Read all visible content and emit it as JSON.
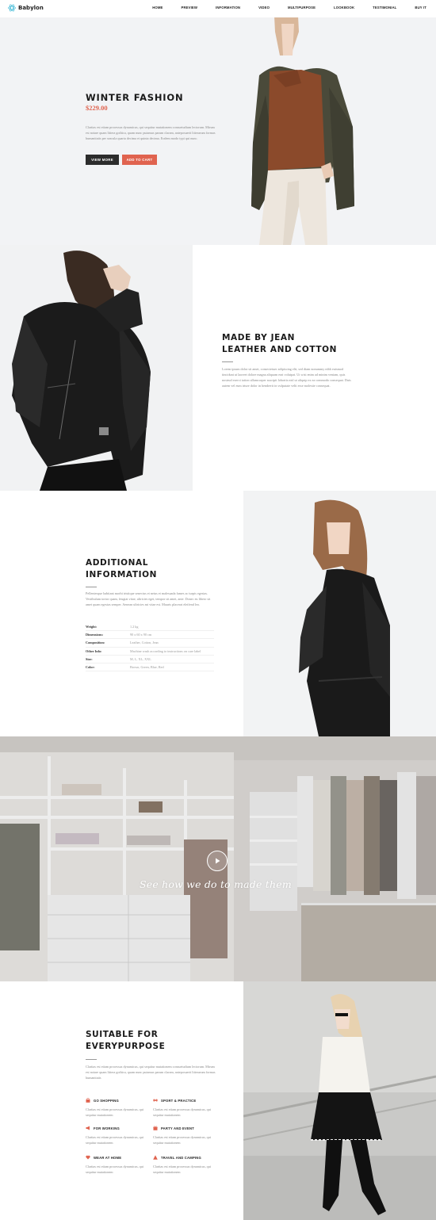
{
  "nav": {
    "logo": "Babylon",
    "items": [
      "HOME",
      "PREVIEW",
      "INFORMATION",
      "VIDEO",
      "MULTIPURPOSE",
      "LOOKBOOK",
      "TESTIMONIAL",
      "BUY IT"
    ]
  },
  "hero": {
    "title": "WINTER FASHION",
    "price": "$229.00",
    "text": "Claritas est etiam processus dynamicus, qui sequitur mutationem consuetudium lectorum. Mirum est notare quam littera gothica, quam nunc putamus parum claram, anteposuerit litterarum formas humanitatis per seacula quarta decima et quinta decima. Eodem modo typi qui nunc.",
    "btn_more": "VIEW MORE",
    "btn_cart": "ADD TO CART"
  },
  "made": {
    "title_line1": "MADE BY JEAN",
    "title_line2": "LEATHER AND COTTON",
    "text": "Lorem ipsum dolor sit amet, consectetuer adipiscing elit, sed diam nonummy nibh euismod tincidunt ut laoreet dolore magna aliquam erat volutpat. Ut wisi enim ad minim veniam, quis nostrud exerci tation ullamcorper suscipit lobortis nisl ut aliquip ex ea commodo consequat. Duis autem vel eum iriure dolor in hendrerit in vulputate velit esse molestie consequat."
  },
  "info": {
    "title_line1": "ADDITIONAL",
    "title_line2": "INFORMATION",
    "text": "Pellentesque habitant morbi tristique senectus et netus et malesuada fames ac turpis egestas. Vestibulum tortor quam, feugiat vitae, ultricies eget, tempor sit amet, ante. Donec eu libero sit amet quam egestas semper. Aenean ultricies mi vitae est. Mauris placerat eleifend leo.",
    "specs": [
      {
        "key": "Weight:",
        "value": "1.2 kg"
      },
      {
        "key": "Dimensions:",
        "value": "90 x 60 x 90 cm"
      },
      {
        "key": "Composition:",
        "value": "Leather, Cotton, Jean"
      },
      {
        "key": "Other Info:",
        "value": "Machine wash according to instructions on care label"
      },
      {
        "key": "Size:",
        "value": "M, L, XL, XXL"
      },
      {
        "key": "Color:",
        "value": "Brown, Green, Blue, Red"
      }
    ]
  },
  "video": {
    "caption": "See  how we do to made them"
  },
  "purpose": {
    "title_line1": "SUITABLE FOR",
    "title_line2": "EVERYPURPOSE",
    "text": "Claritas est etiam processus dynamicus, qui sequitur mutationem consuetudium lectorum. Mirum est notare quam littera gothica, quam nunc putamus parum claram, anteposuerit litterarum formas humanitatis",
    "features": [
      {
        "title": "GO SHOPPING",
        "text": "Claritas est etiam processus dynamicus, qui sequitur mutationem",
        "icon": "shopping-bag-icon"
      },
      {
        "title": "SPORT & PRACTICE",
        "text": "Claritas est etiam processus dynamicus, qui sequitur mutationem",
        "icon": "sport-icon"
      },
      {
        "title": "FOR WORKING",
        "text": "Claritas est etiam processus dynamicus, qui sequitur mutationem",
        "icon": "megaphone-icon"
      },
      {
        "title": "PARTY AND EVENT",
        "text": "Claritas est etiam processus dynamicus, qui sequitur mutationem",
        "icon": "party-icon"
      },
      {
        "title": "WEAR AT HOME",
        "text": "Claritas est etiam processus dynamicus, qui sequitur mutationem",
        "icon": "heart-icon"
      },
      {
        "title": "TRAVEL AND CAMPING",
        "text": "Claritas est etiam processus dynamicus, qui sequitur mutationem",
        "icon": "camping-icon"
      }
    ]
  },
  "colors": {
    "accent": "#e0634f",
    "dark_button": "#2c2c2c",
    "logo": "#3bb8d6"
  }
}
